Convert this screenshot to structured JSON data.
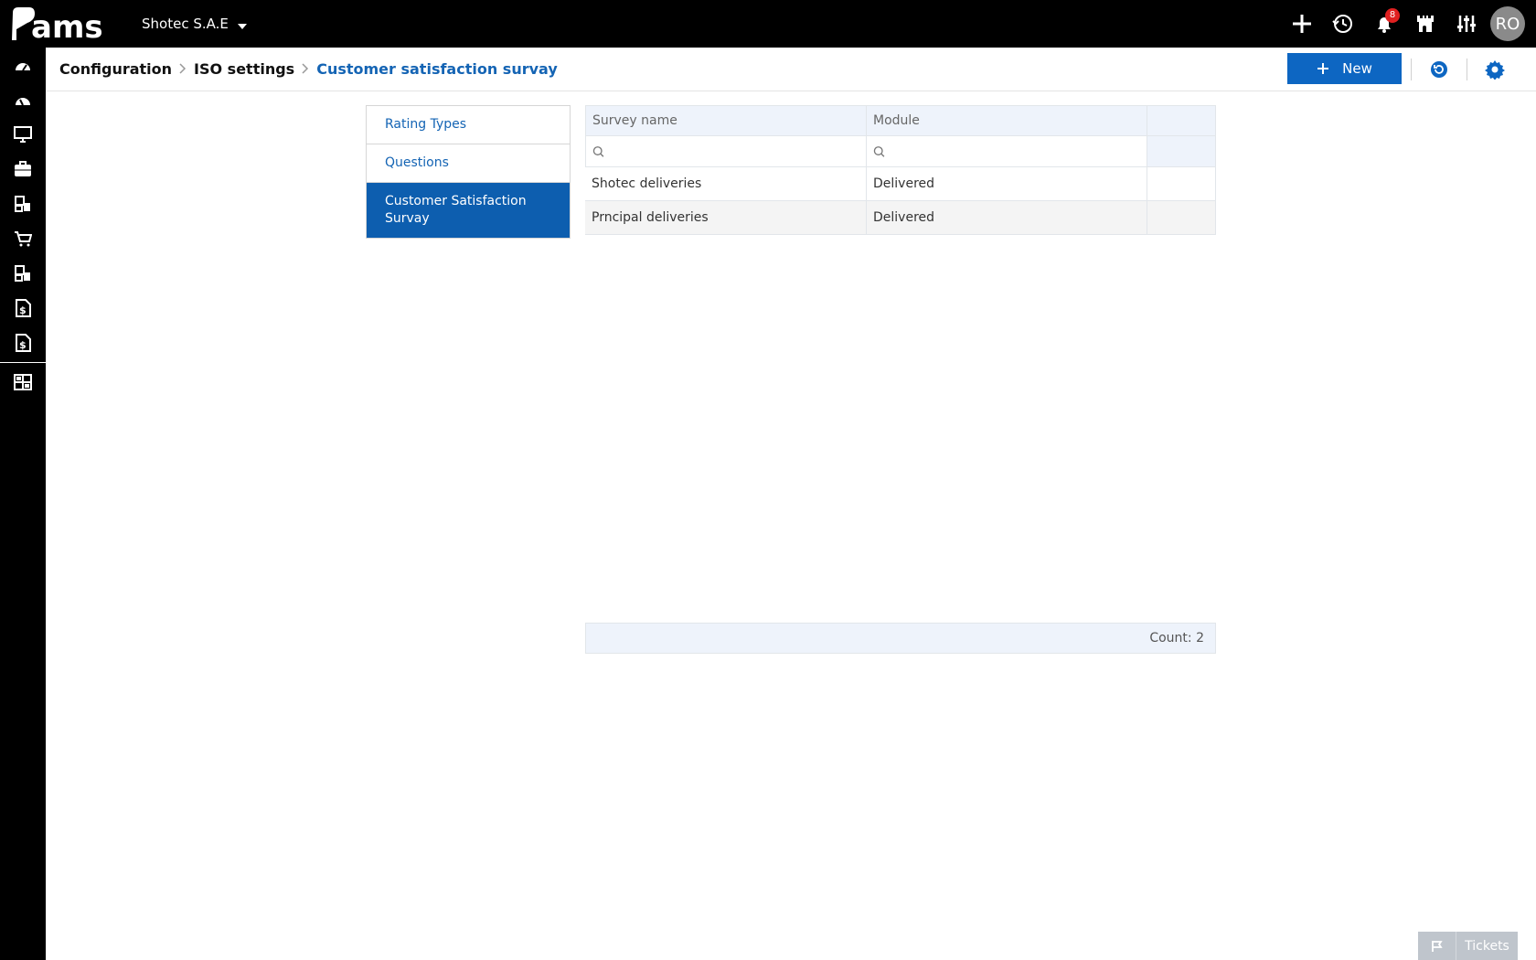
{
  "app": {
    "logo_text": "ams",
    "company": "Shotec S.A.E",
    "notifications_count": "8",
    "user_initials": "RO"
  },
  "breadcrumb": {
    "items": [
      "Configuration",
      "ISO settings"
    ],
    "current": "Customer satisfaction survay"
  },
  "toolbar": {
    "new_label": "New"
  },
  "tabs": [
    {
      "label": "Rating Types"
    },
    {
      "label": "Questions"
    },
    {
      "label": "Customer Satisfaction Survay"
    }
  ],
  "grid": {
    "columns": [
      "Survey name",
      "Module"
    ],
    "rows": [
      {
        "name": "Shotec deliveries",
        "module": "Delivered"
      },
      {
        "name": "Prncipal deliveries",
        "module": "Delivered"
      }
    ],
    "count_label": "Count: 2"
  },
  "tickets": {
    "label": "Tickets"
  },
  "colors": {
    "accent": "#0d66c2",
    "active_tab": "#0d5eaf",
    "link": "#1464b4",
    "topbar": "#000000",
    "badge": "#e02020"
  }
}
